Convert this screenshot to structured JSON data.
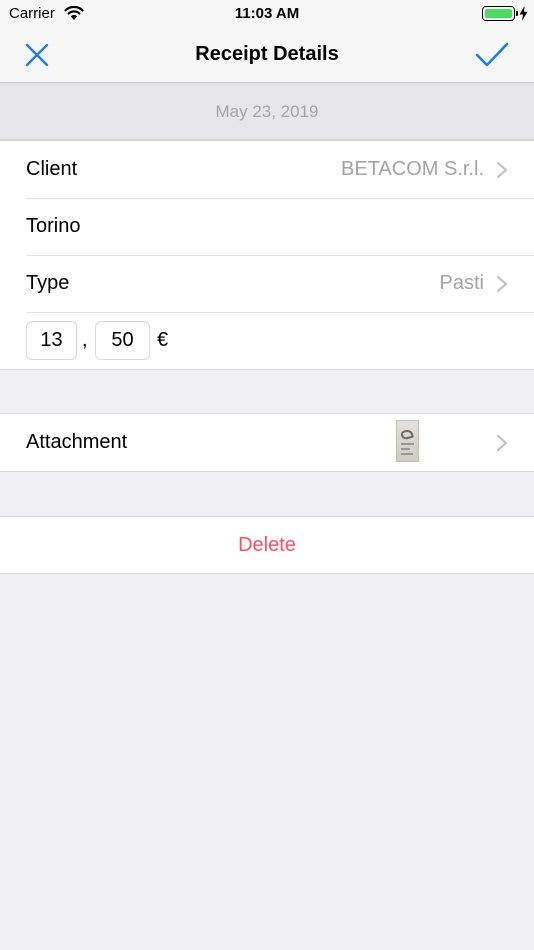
{
  "status_bar": {
    "carrier": "Carrier",
    "time": "11:03 AM",
    "icons": [
      "wifi-icon",
      "battery-icon",
      "charging-bolt-icon"
    ]
  },
  "nav": {
    "title": "Receipt Details",
    "left_icon": "close-icon",
    "right_icon": "checkmark-icon"
  },
  "receipt": {
    "date": "May 23, 2019",
    "client": {
      "label": "Client",
      "value": "BETACOM S.r.l."
    },
    "location": "Torino",
    "type": {
      "label": "Type",
      "value": "Pasti"
    },
    "amount": {
      "integer": "13",
      "separator": ",",
      "decimal": "50",
      "currency": "€"
    }
  },
  "attachment": {
    "label": "Attachment",
    "thumbnail": "receipt-thumbnail-image"
  },
  "delete_label": "Delete",
  "colors": {
    "accent": "#1a7fe0",
    "destructive": "#ff4f5e",
    "secondary_text": "#a3a3a8",
    "background": "#efeff4",
    "battery": "#4cd964"
  }
}
